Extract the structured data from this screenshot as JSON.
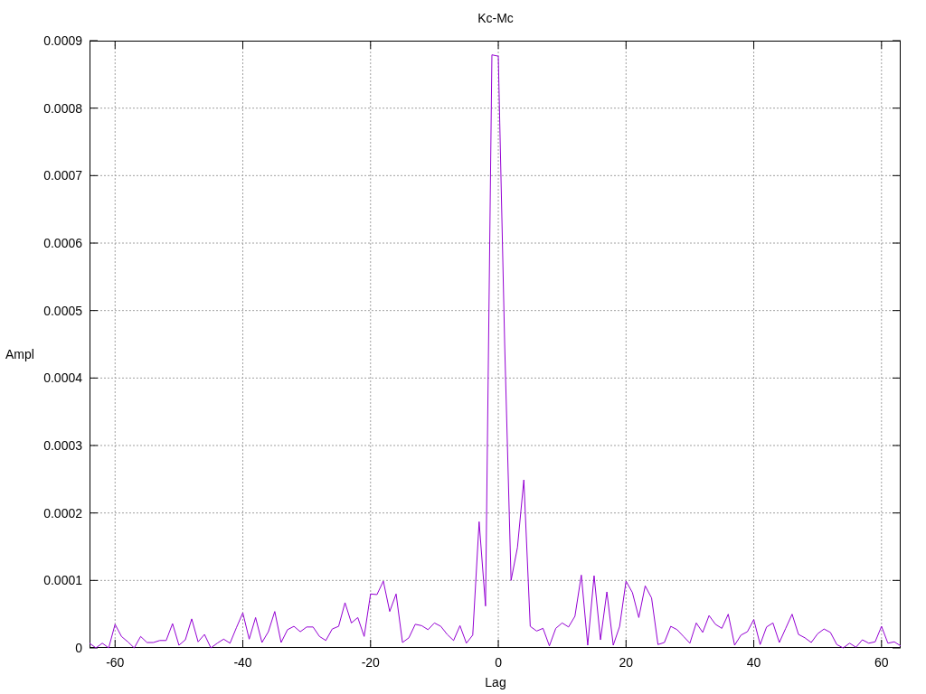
{
  "chart_data": {
    "type": "line",
    "title": "Kc-Mc",
    "xlabel": "Lag",
    "ylabel": "Ampl",
    "xlim": [
      -64,
      63
    ],
    "ylim": [
      0,
      0.0009
    ],
    "grid": true,
    "xticks": [
      -60,
      -40,
      -20,
      0,
      20,
      40,
      60
    ],
    "yticks": [
      0,
      0.0001,
      0.0002,
      0.0003,
      0.0004,
      0.0005,
      0.0006,
      0.0007,
      0.0008,
      0.0009
    ],
    "x": [
      -64,
      -63,
      -62,
      -61,
      -60,
      -59,
      -58,
      -57,
      -56,
      -55,
      -54,
      -53,
      -52,
      -51,
      -50,
      -49,
      -48,
      -47,
      -46,
      -45,
      -44,
      -43,
      -42,
      -41,
      -40,
      -39,
      -38,
      -37,
      -36,
      -35,
      -34,
      -33,
      -32,
      -31,
      -30,
      -29,
      -28,
      -27,
      -26,
      -25,
      -24,
      -23,
      -22,
      -21,
      -20,
      -19,
      -18,
      -17,
      -16,
      -15,
      -14,
      -13,
      -12,
      -11,
      -10,
      -9,
      -8,
      -7,
      -6,
      -5,
      -4,
      -3,
      -2,
      -1,
      0,
      1,
      2,
      3,
      4,
      5,
      6,
      7,
      8,
      9,
      10,
      11,
      12,
      13,
      14,
      15,
      16,
      17,
      18,
      19,
      20,
      21,
      22,
      23,
      24,
      25,
      26,
      27,
      28,
      29,
      30,
      31,
      32,
      33,
      34,
      35,
      36,
      37,
      38,
      39,
      40,
      41,
      42,
      43,
      44,
      45,
      46,
      47,
      48,
      49,
      50,
      51,
      52,
      53,
      54,
      55,
      56,
      57,
      58,
      59,
      60,
      61,
      62,
      63
    ],
    "series": [
      {
        "color": "#9400d3",
        "values": [
          7e-06,
          0,
          7e-06,
          0,
          3.5e-05,
          1.7e-05,
          9e-06,
          0,
          1.7e-05,
          8e-06,
          8e-06,
          1.1e-05,
          1.1e-05,
          3.6e-05,
          4e-06,
          1.2e-05,
          4.3e-05,
          9e-06,
          2e-05,
          0,
          7e-06,
          1.3e-05,
          7e-06,
          3e-05,
          5.2e-05,
          1.3e-05,
          4.5e-05,
          8e-06,
          2.4e-05,
          5.4e-05,
          8e-06,
          2.7e-05,
          3.2e-05,
          2.4e-05,
          3.1e-05,
          3.1e-05,
          1.7e-05,
          1.1e-05,
          2.8e-05,
          3.2e-05,
          6.7e-05,
          3.7e-05,
          4.5e-05,
          1.7e-05,
          8e-05,
          7.9e-05,
          9.9e-05,
          5.4e-05,
          8e-05,
          8e-06,
          1.5e-05,
          3.5e-05,
          3.3e-05,
          2.7e-05,
          3.7e-05,
          3.2e-05,
          2e-05,
          1.1e-05,
          3.3e-05,
          7e-06,
          1.9e-05,
          0.000187,
          6.2e-05,
          0.000879,
          0.000877,
          0.00045,
          0.0001,
          0.000149,
          0.000249,
          3.2e-05,
          2.5e-05,
          2.9e-05,
          3e-06,
          2.9e-05,
          3.7e-05,
          3.1e-05,
          4.7e-05,
          0.000108,
          4e-06,
          0.000107,
          1.2e-05,
          8.3e-05,
          4e-06,
          3.2e-05,
          9.9e-05,
          8.2e-05,
          4.5e-05,
          9.2e-05,
          7.4e-05,
          5e-06,
          8e-06,
          3.2e-05,
          2.7e-05,
          1.7e-05,
          7e-06,
          3.7e-05,
          2.3e-05,
          4.8e-05,
          3.5e-05,
          2.9e-05,
          5e-05,
          4e-06,
          1.9e-05,
          2.4e-05,
          4.2e-05,
          5e-06,
          3.1e-05,
          3.7e-05,
          8e-06,
          2.9e-05,
          5e-05,
          2e-05,
          1.5e-05,
          8e-06,
          2.1e-05,
          2.8e-05,
          2.3e-05,
          5e-06,
          0,
          7e-06,
          1e-06,
          1.2e-05,
          7e-06,
          9e-06,
          3.2e-05,
          7e-06,
          9e-06,
          3e-06
        ]
      }
    ]
  }
}
